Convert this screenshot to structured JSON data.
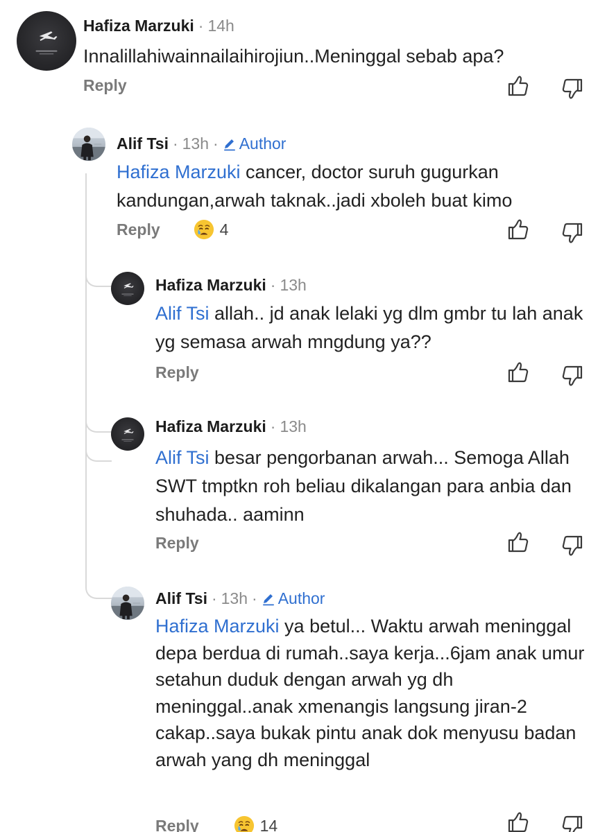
{
  "comments": [
    {
      "author": "Hafiza Marzuki",
      "time": "14h",
      "text": "Innalillahiwainnailaihirojiun..Meninggal sebab apa?",
      "reply_label": "Reply"
    },
    {
      "author": "Alif Tsi",
      "time": "13h",
      "badge": "Author",
      "mention": "Hafiza Marzuki",
      "text": " cancer, doctor suruh gugurkan kandungan,arwah taknak..jadi xboleh buat kimo",
      "reply_label": "Reply",
      "reaction_count": "4"
    },
    {
      "author": "Hafiza Marzuki",
      "time": "13h",
      "mention": "Alif Tsi",
      "text": " allah.. jd anak lelaki yg dlm gmbr tu lah anak yg semasa arwah mngdung ya??",
      "reply_label": "Reply"
    },
    {
      "author": "Hafiza Marzuki",
      "time": "13h",
      "mention": "Alif Tsi",
      "text": " besar pengorbanan arwah... Semoga Allah SWT tmptkn roh beliau dikalangan para anbia dan shuhada.. aaminn",
      "reply_label": "Reply"
    },
    {
      "author": "Alif Tsi",
      "time": "13h",
      "badge": "Author",
      "mention": "Hafiza Marzuki",
      "text": " ya betul... Waktu arwah meninggal depa berdua di rumah..saya kerja...6jam anak umur setahun duduk dengan arwah yg dh meninggal..anak xmenangis langsung jiran-2 cakap..saya bukak pintu anak dok menyusu badan arwah yang dh meninggal",
      "reply_label": "Reply",
      "reaction_count": "14"
    }
  ],
  "icons": {
    "upvote": "thumbs-up-icon",
    "downvote": "thumbs-down-icon",
    "reaction": "crying-face-emoji",
    "author_badge": "pencil-icon"
  },
  "colors": {
    "mention": "#2f6fd0",
    "meta": "#8a8a8a",
    "thread_line": "#d9d9d9"
  }
}
